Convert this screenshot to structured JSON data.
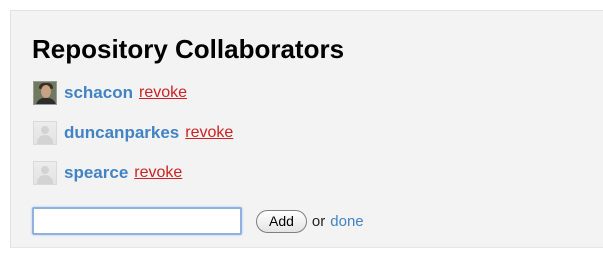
{
  "panel": {
    "title": "Repository Collaborators"
  },
  "collaborators": [
    {
      "username": "schacon",
      "action_label": "revoke",
      "avatar": "user-photo"
    },
    {
      "username": "duncanparkes",
      "action_label": "revoke",
      "avatar": "default-avatar"
    },
    {
      "username": "spearce",
      "action_label": "revoke",
      "avatar": "default-avatar"
    }
  ],
  "add_form": {
    "input_value": "",
    "button_label": "Add",
    "or_text": "or",
    "done_label": "done"
  },
  "colors": {
    "username": "#4183c4",
    "revoke": "#cc2222",
    "panel_background": "#f3f3f3",
    "input_focus_border": "#8fb1df"
  }
}
